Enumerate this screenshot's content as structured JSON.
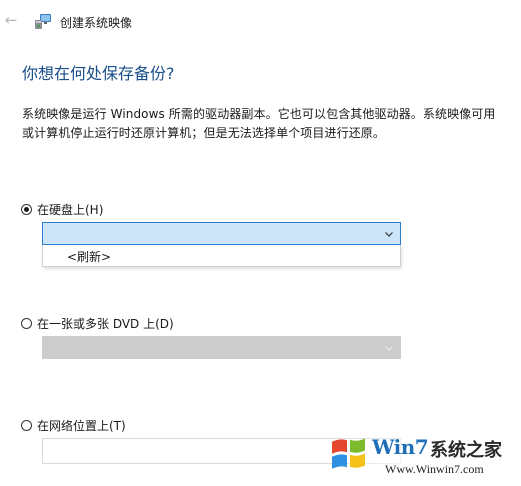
{
  "window": {
    "title": "创建系统映像",
    "back_glyph": "←"
  },
  "heading": "你想在何处保存备份?",
  "description": {
    "line1": "系统映像是运行 Windows 所需的驱动器副本。它也可以包含其他驱动器。系统映像可用",
    "line2": "或计算机停止运行时还原计算机；但是无法选择单个项目进行还原。"
  },
  "options": {
    "hard_disk": {
      "label": "在硬盘上(H)",
      "selected": true,
      "combo_value": "",
      "dropdown_item": "<刷新>"
    },
    "dvd": {
      "label": "在一张或多张 DVD 上(D)",
      "selected": false,
      "combo_value": "",
      "disabled": true
    },
    "network": {
      "label": "在网络位置上(T)",
      "selected": false,
      "input_value": ""
    }
  },
  "watermark": {
    "brand": "Win7",
    "site_name": "系统之家",
    "url": "Www.Winwin7.com"
  },
  "colors": {
    "heading": "#1a4f8b",
    "combo_active_bg": "#cce4f7",
    "combo_active_border": "#2f7fd0",
    "combo_disabled_bg": "#cccccc",
    "watermark_brand": "#1f6fb8"
  },
  "icons": {
    "back": "arrow-left-icon",
    "app": "system-image-backup-icon",
    "dropdown": "chevron-down-icon",
    "watermark": "windows-logo-icon"
  }
}
